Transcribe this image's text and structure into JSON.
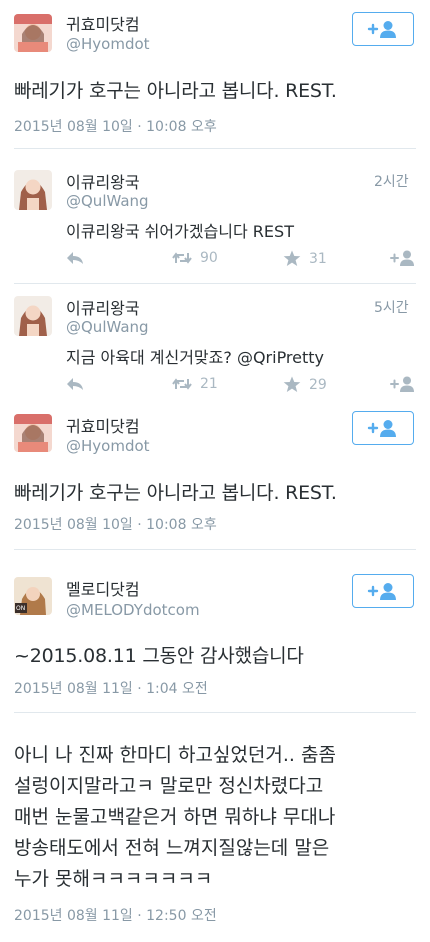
{
  "tweets": [
    {
      "name": "귀효미닷컴",
      "handle": "@Hyomdot",
      "text": "빠레기가 호구는 아니라고 봅니다. REST.",
      "timestamp": "2015년 08월 10일 · 10:08 오후",
      "avatar_color": "#e88a7a"
    },
    {
      "name": "이큐리왕국",
      "handle": "@QulWang",
      "text": "이큐리왕국 쉬어가겠습니다 REST",
      "time_ago": "2시간",
      "retweets": "90",
      "favorites": "31",
      "avatar_color": "#c47d68"
    },
    {
      "name": "이큐리왕국",
      "handle": "@QulWang",
      "text": "지금 아육대 계신거맞죠? @QriPretty",
      "time_ago": "5시간",
      "retweets": "21",
      "favorites": "29",
      "avatar_color": "#c47d68"
    },
    {
      "name": "귀효미닷컴",
      "handle": "@Hyomdot",
      "text": "빠레기가 호구는 아니라고 봅니다. REST.",
      "timestamp": "2015년 08월 10일 · 10:08 오후",
      "avatar_color": "#e88a7a"
    },
    {
      "name": "멜로디닷컴",
      "handle": "@MELODYdotcom",
      "text": "~2015.08.11 그동안 감사했습니다",
      "timestamp": "2015년 08월 11일 · 1:04 오전",
      "avatar_badge": "ON",
      "avatar_color": "#d9b38c"
    },
    {
      "lines": [
        "아니 나 진짜 한마디 하고싶었던거.. 춤좀",
        "설렁이지말라고ㅋ 말로만 정신차렸다고",
        "매번 눈물고백같은거 하면 뭐하냐 무대나",
        "방송태도에서 전혀 느껴지질않는데 말은",
        "누가 못해ㅋㅋㅋㅋㅋㅋㅋ"
      ],
      "timestamp": "2015년 08월 11일 · 12:50 오전"
    }
  ],
  "colors": {
    "accent": "#55acee",
    "muted": "#8899a6",
    "icon": "#aab8c2",
    "text": "#292f33"
  }
}
